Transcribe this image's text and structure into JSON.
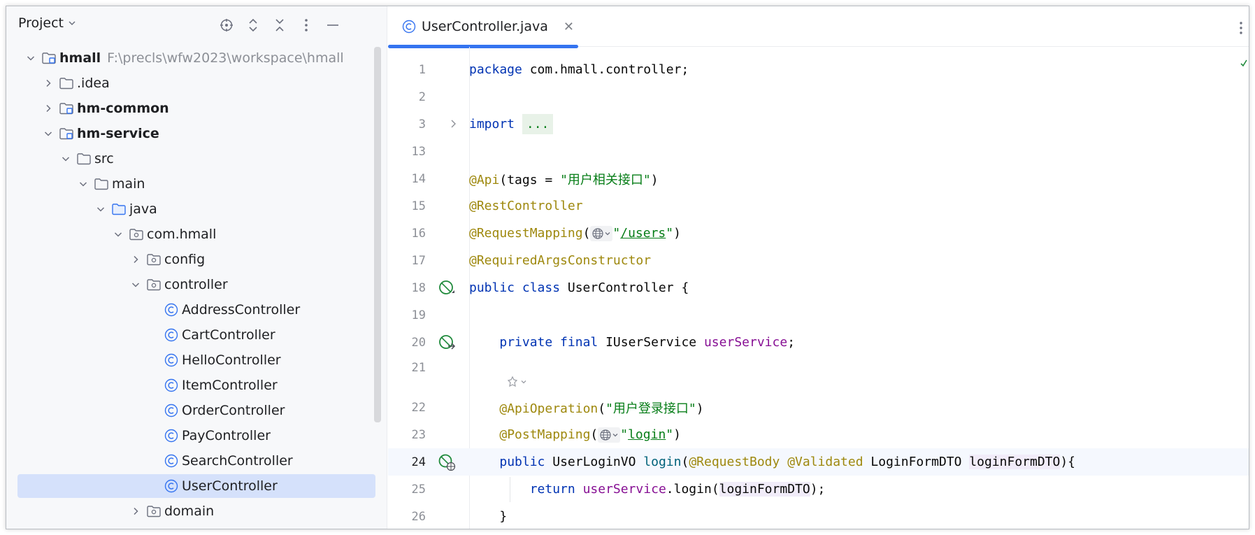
{
  "project_panel": {
    "title": "Project",
    "tree": [
      {
        "label": "hmall",
        "path": "F:\\precls\\wfw2023\\workspace\\hmall",
        "bold": true,
        "icon": "module-folder-icon",
        "expanded": true
      },
      {
        "label": ".idea",
        "icon": "folder-icon",
        "expanded": false
      },
      {
        "label": "hm-common",
        "bold": true,
        "icon": "module-folder-icon",
        "expanded": false
      },
      {
        "label": "hm-service",
        "bold": true,
        "icon": "module-folder-icon",
        "expanded": true
      },
      {
        "label": "src",
        "icon": "folder-icon",
        "expanded": true
      },
      {
        "label": "main",
        "icon": "folder-icon",
        "expanded": true
      },
      {
        "label": "java",
        "icon": "source-folder-icon",
        "expanded": true
      },
      {
        "label": "com.hmall",
        "icon": "package-icon",
        "expanded": true
      },
      {
        "label": "config",
        "icon": "package-icon",
        "expanded": false
      },
      {
        "label": "controller",
        "icon": "package-icon",
        "expanded": true
      },
      {
        "label": "AddressController",
        "icon": "class-icon"
      },
      {
        "label": "CartController",
        "icon": "class-icon"
      },
      {
        "label": "HelloController",
        "icon": "class-icon"
      },
      {
        "label": "ItemController",
        "icon": "class-icon"
      },
      {
        "label": "OrderController",
        "icon": "class-icon"
      },
      {
        "label": "PayController",
        "icon": "class-icon"
      },
      {
        "label": "SearchController",
        "icon": "class-icon"
      },
      {
        "label": "UserController",
        "icon": "class-icon",
        "selected": true
      },
      {
        "label": "domain",
        "icon": "package-icon",
        "expanded": false
      }
    ]
  },
  "editor": {
    "active_tab": "UserController.java",
    "line_numbers": [
      "1",
      "2",
      "3",
      "13",
      "14",
      "15",
      "16",
      "17",
      "18",
      "19",
      "20",
      "21",
      "22",
      "23",
      "24",
      "25",
      "26"
    ],
    "code": {
      "l1_kw": "package",
      "l1_rest": " com.hmall.controller;",
      "l3_kw": "import",
      "l3_fold": "...",
      "l14_ann": "@Api",
      "l14_mid": "(tags = ",
      "l14_str": "\"用户相关接口\"",
      "l14_end": ")",
      "l15_ann": "@RestController",
      "l16_ann": "@RequestMapping",
      "l16_open": "(",
      "l16_q1": "\"",
      "l16_url": "/users",
      "l16_q2": "\"",
      "l16_end": ")",
      "l17_ann": "@RequiredArgsConstructor",
      "l18_kw": "public class",
      "l18_rest": " UserController {",
      "l20_kw": "private final",
      "l20_type": " IUserService ",
      "l20_field": "userService",
      "l20_end": ";",
      "l22_ann": "@ApiOperation",
      "l22_open": "(",
      "l22_str": "\"用户登录接口\"",
      "l22_end": ")",
      "l23_ann": "@PostMapping",
      "l23_open": "(",
      "l23_q1": "\"",
      "l23_url": "login",
      "l23_q2": "\"",
      "l23_end": ")",
      "l24_kw": "public",
      "l24_type": " UserLoginVO ",
      "l24_method": "login",
      "l24_open": "(",
      "l24_ann1": "@RequestBody",
      "l24_sp": " ",
      "l24_ann2": "@Validated",
      "l24_ptype": " LoginFormDTO ",
      "l24_param": "loginFormDTO",
      "l24_end": "){",
      "l25_kw": "return",
      "l25_sp": " ",
      "l25_field": "userService",
      "l25_call": ".login(",
      "l25_arg": "loginFormDTO",
      "l25_end": ");",
      "l26": "}"
    }
  },
  "colors": {
    "keyword": "#0033b3",
    "annotation": "#9e880d",
    "string": "#067d17",
    "field": "#871094",
    "accent": "#3574f0",
    "selection": "#d5e1fb"
  }
}
